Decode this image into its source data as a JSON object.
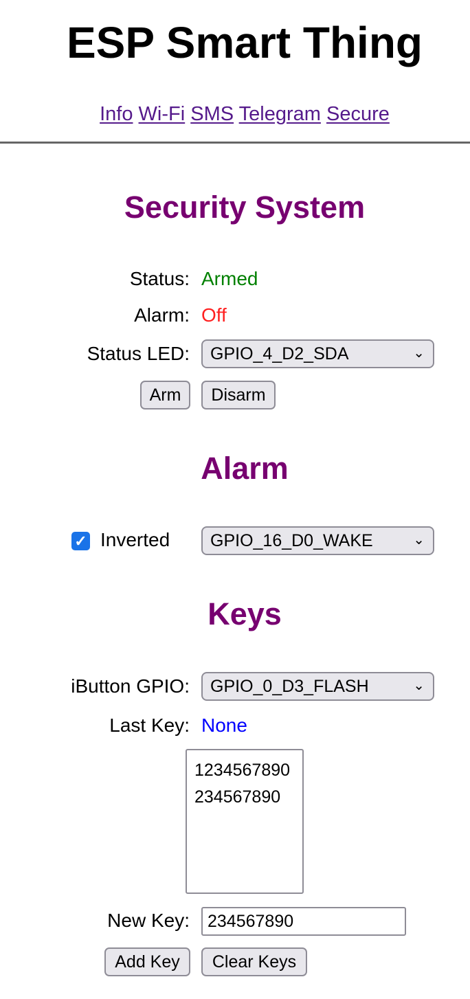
{
  "header": {
    "title": "ESP Smart Thing"
  },
  "nav": {
    "links": [
      "Info",
      "Wi-Fi",
      "SMS",
      "Telegram",
      "Secure"
    ],
    "link_color": "#551a8b"
  },
  "security": {
    "heading": "Security System",
    "status_label": "Status:",
    "status_value": "Armed",
    "status_color": "#008000",
    "alarm_label": "Alarm:",
    "alarm_value": "Off",
    "alarm_color": "#ff2020",
    "led_label": "Status LED:",
    "led_selected": "GPIO_4_D2_SDA",
    "arm_button": "Arm",
    "disarm_button": "Disarm"
  },
  "alarm": {
    "heading": "Alarm",
    "inverted_label": "Inverted",
    "inverted_checked": true,
    "gpio_selected": "GPIO_16_D0_WAKE"
  },
  "keys": {
    "heading": "Keys",
    "ibutton_label": "iButton GPIO:",
    "ibutton_selected": "GPIO_0_D3_FLASH",
    "last_key_label": "Last Key:",
    "last_key_value": "None",
    "last_key_color": "#0000ff",
    "key_list": [
      "1234567890",
      "234567890"
    ],
    "new_key_label": "New Key:",
    "new_key_value": "234567890",
    "add_button": "Add Key",
    "clear_button": "Clear Keys"
  },
  "heading_color": "#770070"
}
